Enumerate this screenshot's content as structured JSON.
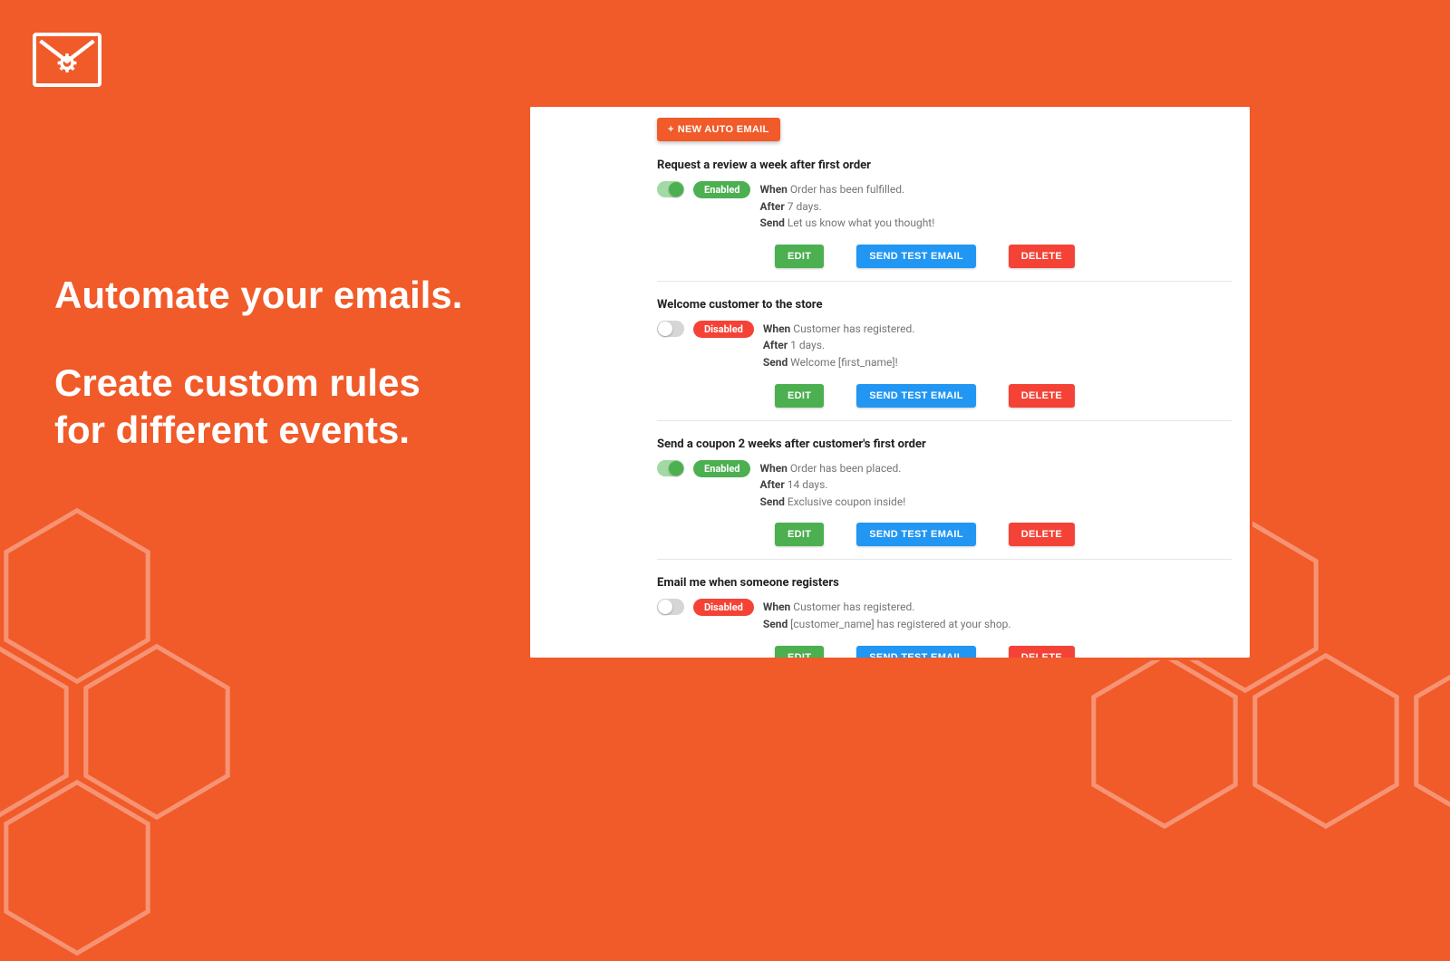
{
  "hero": {
    "line1": "Automate your emails.",
    "line2a": "Create custom rules",
    "line2b": "for different events."
  },
  "panel": {
    "new_button": "NEW AUTO EMAIL",
    "labels": {
      "when": "When",
      "after": "After",
      "send": "Send",
      "enabled": "Enabled",
      "disabled": "Disabled",
      "edit": "EDIT",
      "test": "SEND TEST EMAIL",
      "delete": "DELETE"
    },
    "rules": [
      {
        "title": "Request a review a week after first order",
        "enabled": true,
        "when": "Order has been fulfilled.",
        "after": "7 days.",
        "send": "Let us know what you thought!"
      },
      {
        "title": "Welcome customer to the store",
        "enabled": false,
        "when": "Customer has registered.",
        "after": "1 days.",
        "send": "Welcome [first_name]!"
      },
      {
        "title": "Send a coupon 2 weeks after customer's first order",
        "enabled": true,
        "when": "Order has been placed.",
        "after": "14 days.",
        "send": "Exclusive coupon inside!"
      },
      {
        "title": "Email me when someone registers",
        "enabled": false,
        "when": "Customer has registered.",
        "after": null,
        "send": "[customer_name] has registered at your shop."
      }
    ]
  }
}
